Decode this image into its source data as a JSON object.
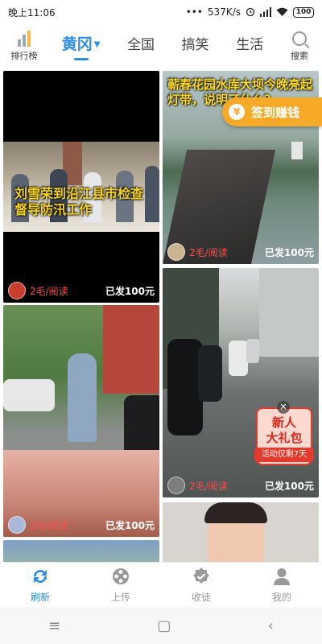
{
  "status_bar": {
    "time": "晚上11:06",
    "network_speed": "537K/s",
    "battery": "100"
  },
  "header": {
    "ranking_label": "排行榜",
    "tabs": [
      {
        "label": "黄冈",
        "active": true
      },
      {
        "label": "全国",
        "active": false
      },
      {
        "label": "搞笑",
        "active": false
      },
      {
        "label": "生活",
        "active": false
      }
    ],
    "search_label": "搜索"
  },
  "feed": {
    "cards": [
      {
        "caption": "刘雪荣到沿江县市检查督导防汛工作",
        "reward": "2毛/阅读",
        "published": "已发100元"
      },
      {
        "caption": "蕲春花园水库大坝今晚亮起灯带，说明了什么？",
        "reward": "2毛/阅读",
        "published": "已发100元"
      },
      {
        "caption": "",
        "reward": "2毛/阅读",
        "published": "已发100元"
      },
      {
        "caption": "",
        "reward": "2毛/阅读",
        "published": "已发100元"
      },
      {
        "caption": "",
        "reward": "",
        "published": ""
      },
      {
        "caption": "",
        "reward": "",
        "published": ""
      }
    ]
  },
  "checkin": {
    "label": "签到赚钱",
    "coin_symbol": "¥"
  },
  "gift": {
    "title_line1": "新人",
    "title_line2": "大礼包",
    "ribbon": "活动仅剩7天",
    "close": "✕"
  },
  "bottom_nav": [
    {
      "label": "刷新",
      "icon": "refresh-icon",
      "active": true
    },
    {
      "label": "上传",
      "icon": "film-reel-icon",
      "active": false
    },
    {
      "label": "收徒",
      "icon": "badge-check-icon",
      "active": false
    },
    {
      "label": "我的",
      "icon": "user-icon",
      "active": false
    }
  ],
  "system_nav": {
    "menu": "≡",
    "home": "▢",
    "back": "‹"
  },
  "colors": {
    "accent": "#2c8ce8",
    "reward_red": "#ff4d4d",
    "checkin_orange": "#f7a928",
    "gift_red": "#e23b2e"
  }
}
